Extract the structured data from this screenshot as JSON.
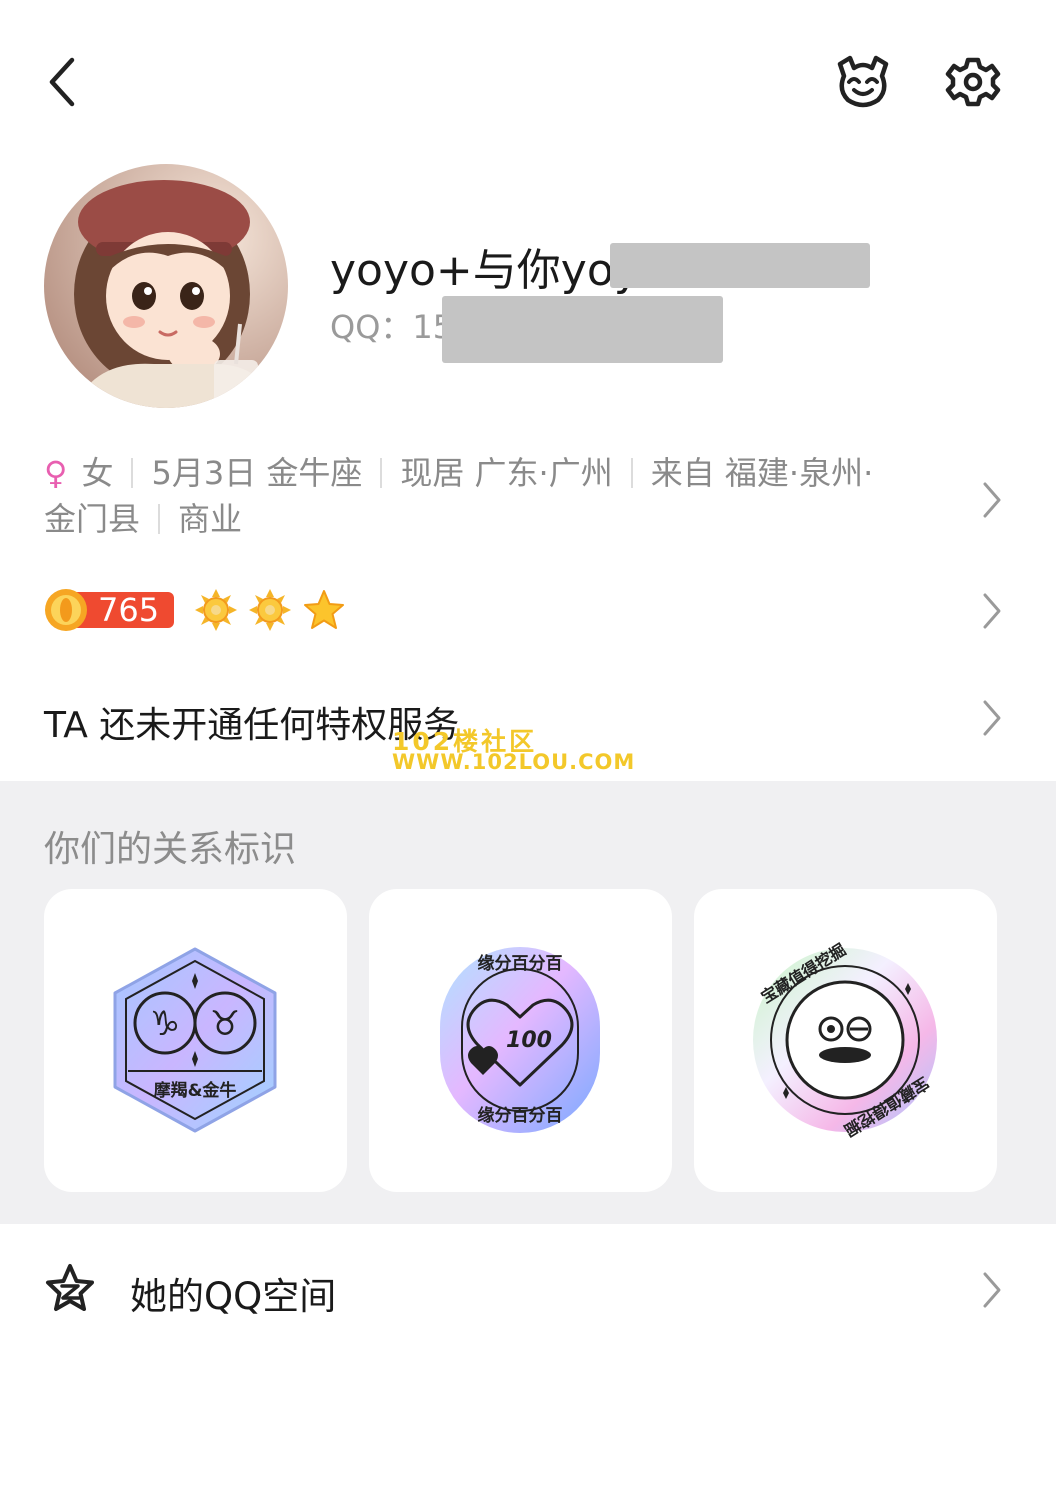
{
  "header": {
    "back_icon": "chevron-left-icon",
    "pet_icon": "pet-face-icon",
    "settings_icon": "gear-icon"
  },
  "profile": {
    "nickname": "yoyo+与你yoy",
    "qq_label": "QQ：15",
    "avatar": "avatar-girl-beret"
  },
  "info": {
    "gender_symbol": "♀",
    "gender": "女",
    "birthday": "5月3日 金牛座",
    "residence": "现居 广东·广州",
    "hometown": "来自 福建·泉州·",
    "hometown_cont": "金门县",
    "occupation": "商业"
  },
  "level": {
    "value": "765",
    "icons": [
      "sun-icon",
      "sun-icon",
      "star-icon"
    ]
  },
  "privilege": {
    "text": "TA 还未开通任何特权服务"
  },
  "watermark": {
    "line1": "102楼社区",
    "line2": "WWW.102LOU.COM"
  },
  "relations": {
    "title": "你们的关系标识",
    "cards": [
      {
        "label": "摩羯&金牛",
        "icon": "zodiac-hexagon-badge"
      },
      {
        "label_top": "缘分百分百",
        "label_bottom": "缘分百分百",
        "number": "100",
        "icon": "heart-100-badge"
      },
      {
        "label": "宝藏值得挖掘",
        "icon": "treasure-face-badge"
      }
    ]
  },
  "qzone": {
    "label": "她的QQ空间",
    "icon": "qzone-star-icon"
  },
  "colors": {
    "female": "#e85fb0",
    "section_bg": "#f0f0f2",
    "watermark": "#f3c82a",
    "level_bg": "#ef4a30"
  }
}
